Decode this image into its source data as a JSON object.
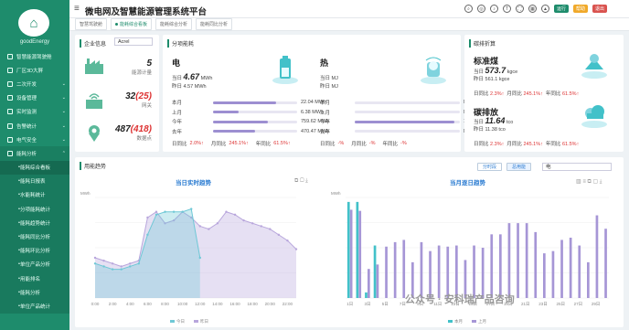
{
  "app": {
    "brand": "goodEnergy",
    "title": "微电网及智慧能源管理系统平台"
  },
  "sidebar": {
    "items": [
      {
        "label": "智慧能源驾驶舱",
        "kind": "top"
      },
      {
        "label": "厂区3D大屏",
        "kind": "top"
      },
      {
        "label": "二次开发",
        "kind": "top",
        "arrow": "⌄"
      },
      {
        "label": "设备管理",
        "kind": "top",
        "arrow": "⌄"
      },
      {
        "label": "实时监测",
        "kind": "top",
        "arrow": "⌄"
      },
      {
        "label": "告警统计",
        "kind": "top",
        "arrow": "⌄"
      },
      {
        "label": "电气安全",
        "kind": "top",
        "arrow": "⌄"
      },
      {
        "label": "能耗分析",
        "kind": "grp",
        "arrow": "⌃"
      },
      {
        "label": "能耗综合看板",
        "kind": "sub",
        "active": true
      },
      {
        "label": "能耗日报表",
        "kind": "sub"
      },
      {
        "label": "水能耗统计",
        "kind": "sub"
      },
      {
        "label": "分项能耗统计",
        "kind": "sub"
      },
      {
        "label": "能耗趋势统计",
        "kind": "sub"
      },
      {
        "label": "能耗同比分析",
        "kind": "sub"
      },
      {
        "label": "能耗环比分析",
        "kind": "sub"
      },
      {
        "label": "单位产品分析",
        "kind": "sub"
      },
      {
        "label": "用能排名",
        "kind": "sub"
      },
      {
        "label": "能耗分析",
        "kind": "sub"
      },
      {
        "label": "单位产品统计",
        "kind": "sub"
      }
    ]
  },
  "topbar": {
    "badges": [
      "运行",
      "帮助",
      "退出"
    ],
    "badge_colors": [
      "#1e8c6c",
      "#f0a92a",
      "#d9534f"
    ]
  },
  "tabs": [
    {
      "label": "智慧驾驶舱",
      "active": false
    },
    {
      "label": "能耗综合看板",
      "active": true
    },
    {
      "label": "能耗综合分析",
      "active": false
    },
    {
      "label": "能耗同比分析",
      "active": false
    }
  ],
  "enterprise": {
    "title": "企业信息",
    "select_value": "Acrel",
    "stats": [
      {
        "value": "5",
        "label": "能源计量"
      },
      {
        "value": "32",
        "extra": "(25)",
        "label": "网关"
      },
      {
        "value": "487",
        "extra": "(418)",
        "label": "数据点"
      }
    ]
  },
  "energy": {
    "title": "分项能耗",
    "electric": {
      "name": "电",
      "today": "4.67",
      "today_unit": "MWh",
      "yesterday": "4.57 MWh",
      "rows": [
        {
          "label": "本月",
          "value": "22.04 MWh",
          "pct": 0.75
        },
        {
          "label": "上月",
          "value": "6.38 MWh",
          "pct": 0.3
        },
        {
          "label": "今年",
          "value": "759.62 MWh",
          "pct": 0.65
        },
        {
          "label": "去年",
          "value": "470.47 MWh",
          "pct": 0.5
        }
      ],
      "compare": [
        {
          "label": "日同比",
          "value": "2.0%↑"
        },
        {
          "label": "月同比",
          "value": "245.1%↑"
        },
        {
          "label": "年同比",
          "value": "61.5%↑"
        }
      ]
    },
    "heat": {
      "name": "热",
      "today": "",
      "today_unit": "MJ",
      "yesterday": "MJ",
      "rows": [
        {
          "label": "本月",
          "value": "MJ",
          "pct": 0
        },
        {
          "label": "上月",
          "value": "MJ",
          "pct": 0
        },
        {
          "label": "今年",
          "value": "131MJ",
          "pct": 0.95
        },
        {
          "label": "去年",
          "value": "MJ",
          "pct": 0
        }
      ],
      "compare": [
        {
          "label": "日同比",
          "value": "-%"
        },
        {
          "label": "月同比",
          "value": "-%"
        },
        {
          "label": "年同比",
          "value": "-%"
        }
      ]
    }
  },
  "carbon": {
    "title": "碳排折算",
    "coal": {
      "name": "标准煤",
      "today_label": "当日",
      "today": "573.7",
      "unit": "kgce",
      "yesterday": "昨日 561.1 kgce",
      "compare": [
        {
          "label": "日同比",
          "value": "2.3%↑"
        },
        {
          "label": "月同比",
          "value": "245.1%↑"
        },
        {
          "label": "年同比",
          "value": "61.5%↑"
        }
      ]
    },
    "co2": {
      "name": "碳排放",
      "today_label": "当日",
      "today": "11.64",
      "unit": "tco",
      "yesterday": "昨日 11.38 tco",
      "compare": [
        {
          "label": "日同比",
          "value": "2.3%↑"
        },
        {
          "label": "月同比",
          "value": "245.1%↑"
        },
        {
          "label": "年同比",
          "value": "61.5%↑"
        }
      ]
    }
  },
  "trend": {
    "title": "用能趋势",
    "btn_group": [
      "分时段",
      "总用能"
    ],
    "type_select": "电"
  },
  "chart_data": [
    {
      "type": "area",
      "title": "当日实时趋势",
      "ylabel": "MWh",
      "x": [
        "0:00",
        "1:00",
        "2:00",
        "3:00",
        "4:00",
        "5:00",
        "6:00",
        "7:00",
        "8:00",
        "9:00",
        "10:00",
        "11:00",
        "12:00",
        "13:00",
        "14:00",
        "15:00",
        "16:00",
        "17:00",
        "18:00",
        "19:00",
        "20:00",
        "21:00",
        "22:00",
        "23:00"
      ],
      "ylim": [
        0,
        0.35
      ],
      "series": [
        {
          "name": "今日",
          "color": "#6fc8d6",
          "values": [
            0.12,
            0.11,
            0.1,
            0.1,
            0.11,
            0.12,
            0.22,
            0.29,
            0.3,
            0.3,
            0.3,
            0.31,
            0.14,
            null,
            null,
            null,
            null,
            null,
            null,
            null,
            null,
            null,
            null,
            null
          ]
        },
        {
          "name": "昨日",
          "color": "#b8a6dc",
          "values": [
            0.14,
            0.13,
            0.12,
            0.11,
            0.12,
            0.13,
            0.28,
            0.3,
            0.26,
            0.27,
            0.3,
            0.28,
            0.25,
            0.24,
            0.26,
            0.3,
            0.29,
            0.27,
            0.26,
            0.25,
            0.24,
            0.22,
            0.2,
            0.17
          ]
        }
      ]
    },
    {
      "type": "bar",
      "title": "当月逐日趋势",
      "ylabel": "MWh",
      "x": [
        "1日",
        "2日",
        "3日",
        "4日",
        "5日",
        "6日",
        "7日",
        "8日",
        "9日",
        "10日",
        "11日",
        "12日",
        "13日",
        "14日",
        "15日",
        "16日",
        "17日",
        "18日",
        "19日",
        "20日",
        "21日",
        "22日",
        "23日",
        "24日",
        "25日",
        "26日",
        "27日",
        "28日",
        "29日",
        "30日"
      ],
      "ylim": [
        0,
        9
      ],
      "series": [
        {
          "name": "本月",
          "color": "#42c1c9",
          "values": [
            8.6,
            8.6,
            0.5,
            4.7,
            null,
            null,
            null,
            null,
            null,
            null,
            null,
            null,
            null,
            null,
            null,
            null,
            null,
            null,
            null,
            null,
            null,
            null,
            null,
            null,
            null,
            null,
            null,
            null,
            null,
            null
          ]
        },
        {
          "name": "上月",
          "color": "#a696d6",
          "values": [
            7.9,
            7.8,
            2.6,
            3.0,
            4.6,
            5.0,
            5.2,
            3.2,
            5.0,
            4.2,
            4.7,
            4.6,
            4.7,
            3.4,
            4.7,
            4.5,
            5.7,
            5.7,
            6.7,
            6.7,
            6.7,
            5.9,
            4.0,
            4.2,
            5.2,
            5.4,
            4.7,
            3.2,
            7.4,
            6.2
          ]
        }
      ]
    }
  ],
  "watermark": "公众号 · 安科瑞产品咨询"
}
